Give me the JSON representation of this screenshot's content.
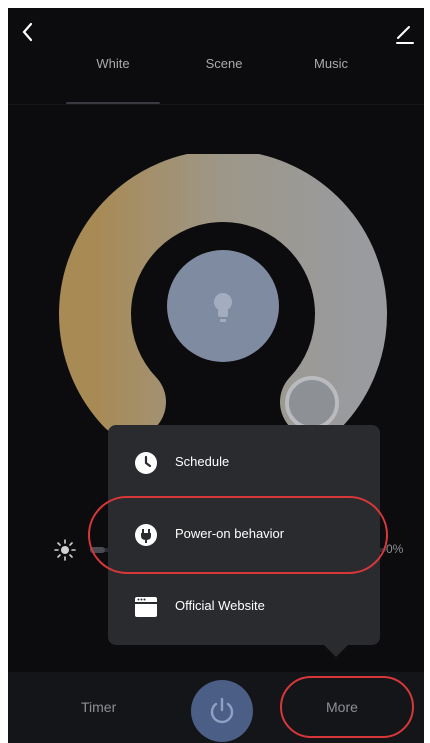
{
  "header": {
    "back_icon": "chevron-left-icon",
    "edit_icon": "edit-pencil-icon"
  },
  "tabs": [
    {
      "label": "White",
      "selected": true
    },
    {
      "label": "Scene",
      "selected": false
    },
    {
      "label": "Music",
      "selected": false
    }
  ],
  "color_wheel": {
    "warm_color": "#a88a55",
    "cool_color": "#9a9b9e",
    "center_color": "#7f8ba1",
    "bulb_icon": "bulb-icon",
    "handle_icon": "temperature-handle"
  },
  "brightness": {
    "icon": "sun-icon",
    "value_text": "0%",
    "level": 0.05
  },
  "popup_menu": {
    "items": [
      {
        "label": "Schedule",
        "icon": "clock-icon"
      },
      {
        "label": "Power-on behavior",
        "icon": "plug-icon",
        "highlighted": true
      },
      {
        "label": "Official Website",
        "icon": "browser-window-icon"
      }
    ]
  },
  "bottom_bar": {
    "timer_label": "Timer",
    "power_icon": "power-icon",
    "more_label": "More",
    "more_highlighted": true
  },
  "colors": {
    "background": "#0c0c0e",
    "menu_background": "#2a2b2f",
    "highlight_red": "#d8373a",
    "power_button": "#4b5e86"
  }
}
